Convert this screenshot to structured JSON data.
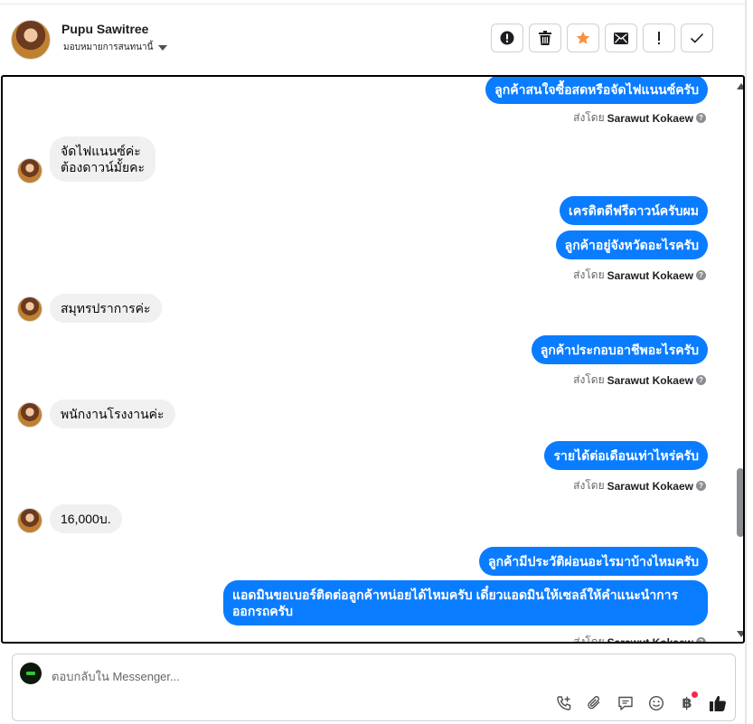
{
  "header": {
    "name": "Pupu Sawitree",
    "assign_label": "มอบหมายการสนทนานี้"
  },
  "actions": [
    {
      "icon": "alert-circle-icon"
    },
    {
      "icon": "trash-icon"
    },
    {
      "icon": "star-icon",
      "color": "#f7923b"
    },
    {
      "icon": "envelope-icon"
    },
    {
      "icon": "exclamation-icon"
    },
    {
      "icon": "check-icon"
    }
  ],
  "sender_prefix": "ส่งโดย",
  "sender_name": "Sarawut Kokaew",
  "messages": {
    "m1": "ลูกค้าสนใจซื้อสดหรือจัดไฟแนนซ์ครับ",
    "m2_line1": "จัดไฟแนนซ์ค่ะ",
    "m2_line2": "ต้องดาวน์มั้ยคะ",
    "m3": "เครดิตดีฟรีดาวน์ครับผม",
    "m4": "ลูกค้าอยู่จังหวัดอะไรครับ",
    "m5": "สมุทรปราการค่ะ",
    "m6": "ลูกค้าประกอบอาชีพอะไรครับ",
    "m7": "พนักงานโรงงานค่ะ",
    "m8": "รายได้ต่อเดือนเท่าไหร่ครับ",
    "m9": "16,000บ.",
    "m10": "ลูกค้ามีประวัติผ่อนอะไรมาบ้างไหมครับ",
    "m11": "แอดมินขอเบอร์ติดต่อลูกค้าหน่อยได้ไหมครับ เดี๋ยวแอดมินให้เซลล์ให้คำแนะนำการออกรถครับ"
  },
  "composer": {
    "placeholder": "ตอบกลับใน Messenger..."
  },
  "colors": {
    "outgoing_bubble": "#0a7cff",
    "incoming_bubble": "#f0f0f0"
  }
}
